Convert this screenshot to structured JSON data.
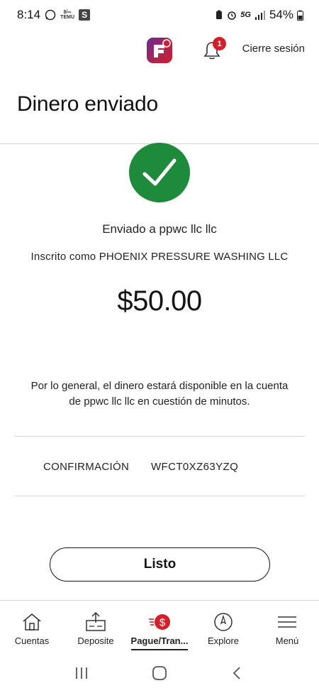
{
  "status_bar": {
    "time": "8:14",
    "mini_text": "8/∞ TEMU",
    "s_badge": "S",
    "network": "5G",
    "battery": "54%"
  },
  "header": {
    "bell_badge": "1",
    "signout_label": "Cierre sesión"
  },
  "page": {
    "title": "Dinero enviado",
    "sent_to": "Enviado a ppwc llc llc",
    "enrolled_as": "Inscrito como PHOENIX PRESSURE WASHING LLC",
    "amount": "$50.00",
    "note": "Por lo general, el dinero estará disponible en la cuenta de ppwc llc llc en cuestión de minutos."
  },
  "confirmation": {
    "label": "CONFIRMACIÓN",
    "value": "WFCT0XZ63YZQ"
  },
  "done_label": "Listo",
  "bottom_nav": {
    "items": [
      {
        "label": "Cuentas",
        "icon": "house-icon"
      },
      {
        "label": "Deposite",
        "icon": "deposit-icon"
      },
      {
        "label": "Pague/Tran...",
        "icon": "pay-transfer-icon"
      },
      {
        "label": "Explore",
        "icon": "compass-icon"
      },
      {
        "label": "Menú",
        "icon": "hamburger-icon"
      }
    ]
  },
  "colors": {
    "check_green": "#1d8a3c",
    "brand_red": "#d71e28",
    "brand_purple": "#6b2c91"
  }
}
